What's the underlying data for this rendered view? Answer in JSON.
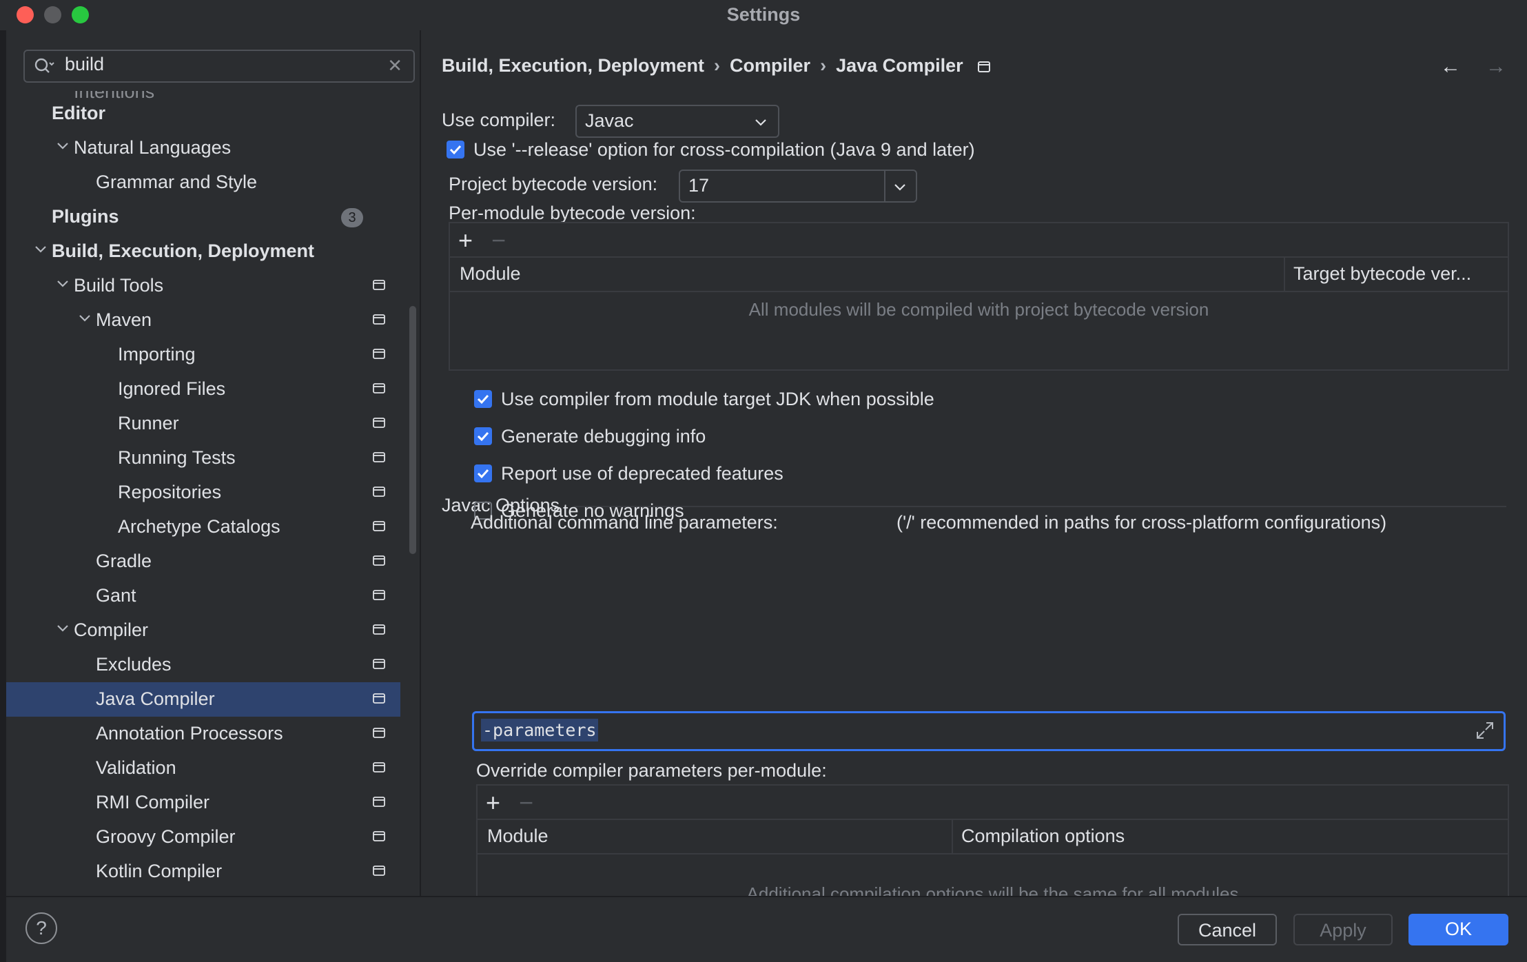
{
  "window": {
    "title": "Settings"
  },
  "search": {
    "value": "build"
  },
  "sidebar": {
    "partial_item": "Intentions",
    "items": [
      {
        "label": "Editor",
        "level": 0,
        "bold": true,
        "chevron": "none"
      },
      {
        "label": "Natural Languages",
        "level": 1,
        "bold": false,
        "chevron": "down"
      },
      {
        "label": "Grammar and Style",
        "level": 2,
        "bold": false,
        "chevron": "none"
      },
      {
        "label": "Plugins",
        "level": 0,
        "bold": true,
        "chevron": "none",
        "badge": "3"
      },
      {
        "label": "Build, Execution, Deployment",
        "level": 0,
        "bold": true,
        "chevron": "down"
      },
      {
        "label": "Build Tools",
        "level": 1,
        "bold": false,
        "chevron": "down",
        "page_icon": true
      },
      {
        "label": "Maven",
        "level": 2,
        "bold": false,
        "chevron": "down",
        "page_icon": true
      },
      {
        "label": "Importing",
        "level": 3,
        "bold": false,
        "chevron": "none",
        "page_icon": true
      },
      {
        "label": "Ignored Files",
        "level": 3,
        "bold": false,
        "chevron": "none",
        "page_icon": true
      },
      {
        "label": "Runner",
        "level": 3,
        "bold": false,
        "chevron": "none",
        "page_icon": true
      },
      {
        "label": "Running Tests",
        "level": 3,
        "bold": false,
        "chevron": "none",
        "page_icon": true
      },
      {
        "label": "Repositories",
        "level": 3,
        "bold": false,
        "chevron": "none",
        "page_icon": true
      },
      {
        "label": "Archetype Catalogs",
        "level": 3,
        "bold": false,
        "chevron": "none",
        "page_icon": true
      },
      {
        "label": "Gradle",
        "level": 2,
        "bold": false,
        "chevron": "none",
        "page_icon": true
      },
      {
        "label": "Gant",
        "level": 2,
        "bold": false,
        "chevron": "none",
        "page_icon": true
      },
      {
        "label": "Compiler",
        "level": 1,
        "bold": false,
        "chevron": "down",
        "page_icon": true
      },
      {
        "label": "Excludes",
        "level": 2,
        "bold": false,
        "chevron": "none",
        "page_icon": true
      },
      {
        "label": "Java Compiler",
        "level": 2,
        "bold": false,
        "chevron": "none",
        "page_icon": true,
        "selected": true
      },
      {
        "label": "Annotation Processors",
        "level": 2,
        "bold": false,
        "chevron": "none",
        "page_icon": true
      },
      {
        "label": "Validation",
        "level": 2,
        "bold": false,
        "chevron": "none",
        "page_icon": true
      },
      {
        "label": "RMI Compiler",
        "level": 2,
        "bold": false,
        "chevron": "none",
        "page_icon": true
      },
      {
        "label": "Groovy Compiler",
        "level": 2,
        "bold": false,
        "chevron": "none",
        "page_icon": true
      },
      {
        "label": "Kotlin Compiler",
        "level": 2,
        "bold": false,
        "chevron": "none",
        "page_icon": true
      }
    ]
  },
  "breadcrumb": [
    "Build, Execution, Deployment",
    "Compiler",
    "Java Compiler"
  ],
  "compiler": {
    "use_compiler_label": "Use compiler:",
    "use_compiler_value": "Javac",
    "release_option_label": "Use '--release' option for cross-compilation (Java 9 and later)",
    "release_option_checked": true,
    "project_bytecode_label": "Project bytecode version:",
    "project_bytecode_value": "17",
    "per_module_label": "Per-module bytecode version:",
    "per_module_table": {
      "columns": [
        "Module",
        "Target bytecode ver..."
      ],
      "empty_text": "All modules will be compiled with project bytecode version"
    }
  },
  "javac": {
    "section_title": "Javac Options",
    "options": [
      {
        "label": "Use compiler from module target JDK when possible",
        "checked": true
      },
      {
        "label": "Generate debugging info",
        "checked": true
      },
      {
        "label": "Report use of deprecated features",
        "checked": true
      },
      {
        "label": "Generate no warnings",
        "checked": false
      }
    ],
    "additional_params_label": "Additional command line parameters:",
    "additional_params_hint": "('/' recommended in paths for cross-platform configurations)",
    "additional_params_value": "-parameters",
    "override_label": "Override compiler parameters per-module:",
    "override_table": {
      "columns": [
        "Module",
        "Compilation options"
      ],
      "empty_text": "Additional compilation options will be the same for all modules"
    }
  },
  "footer": {
    "help": "?",
    "cancel": "Cancel",
    "apply": "Apply",
    "ok": "OK"
  },
  "colors": {
    "accent": "#3574f0",
    "selection": "#2e436e",
    "background": "#2b2d30"
  }
}
